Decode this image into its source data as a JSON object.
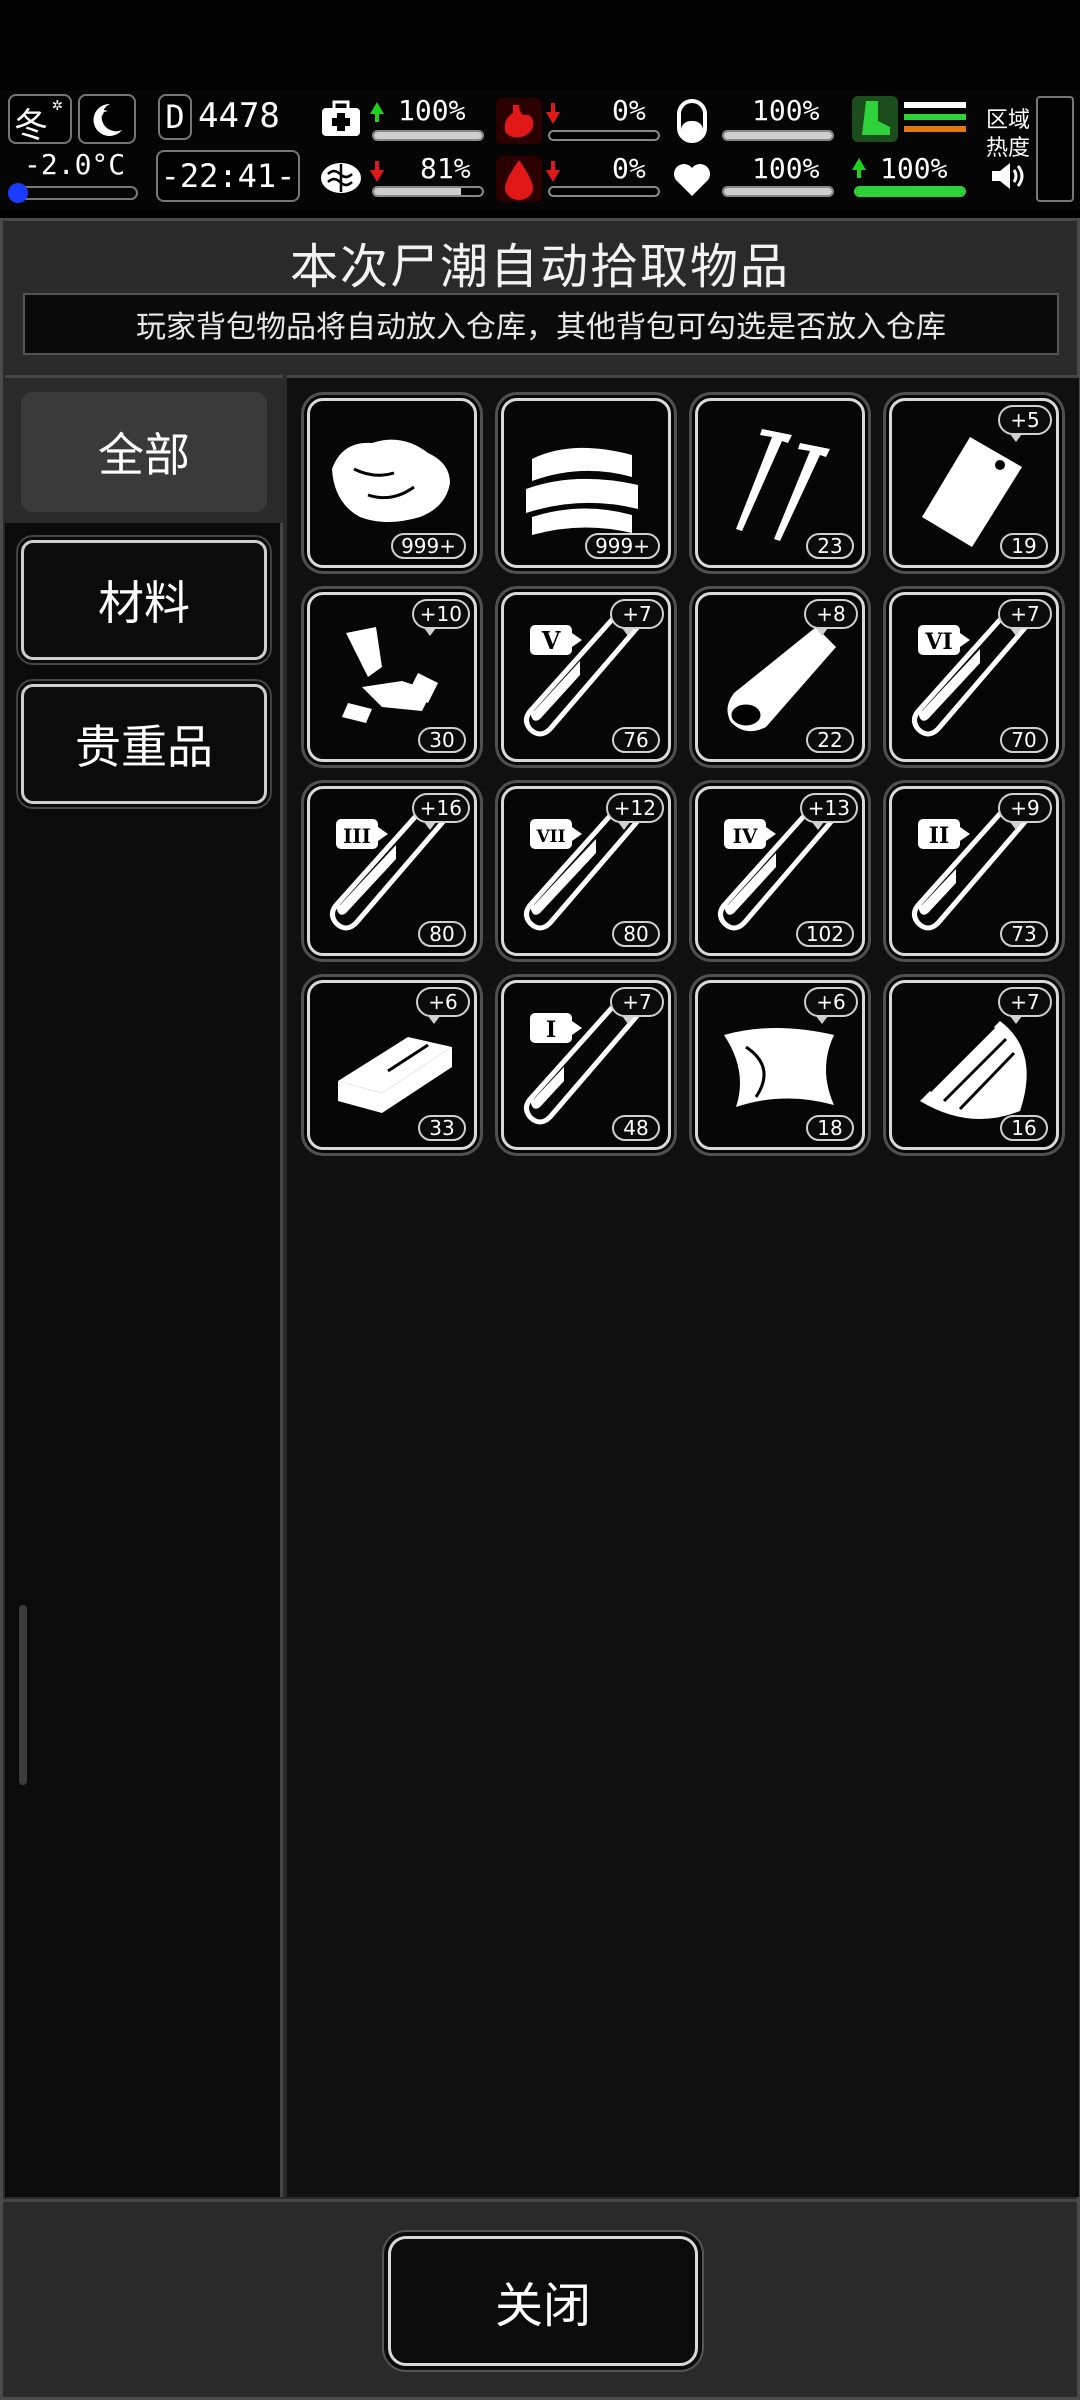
{
  "hud": {
    "season": "冬",
    "temperature": "-2.0°C",
    "day_counter": "4478",
    "day_prefix": "D",
    "clock": "-22:41-",
    "stats": {
      "health": {
        "value": "100%",
        "trend": "up",
        "level": 1.0
      },
      "hunger": {
        "value": "0%",
        "trend": "down",
        "level": 0.0
      },
      "medicine": {
        "value": "100%",
        "level": 1.0
      },
      "sanity": {
        "value": "81%",
        "trend": "down",
        "level": 0.81
      },
      "bleeding": {
        "value": "0%",
        "trend": "down",
        "level": 0.0
      },
      "heart": {
        "value": "100%",
        "level": 1.0
      },
      "stamina": {
        "value": "100%",
        "trend": "up",
        "level": 1.0
      }
    },
    "zone_heat_label_1": "区域",
    "zone_heat_label_2": "热度",
    "colors": {
      "up": "#1ed11e",
      "down": "#e01818",
      "stamina": "#2fd23a"
    }
  },
  "panel": {
    "title": "本次尸潮自动拾取物品",
    "notice": "玩家背包物品将自动放入仓库，其他背包可勾选是否放入仓库"
  },
  "categories": [
    {
      "label": "全部",
      "active": true
    },
    {
      "label": "材料",
      "active": false
    },
    {
      "label": "贵重品",
      "active": false
    }
  ],
  "items": [
    {
      "icon": "cloth-sack-icon",
      "count": "999+",
      "bonus": ""
    },
    {
      "icon": "folded-cloth-icon",
      "count": "999+",
      "bonus": ""
    },
    {
      "icon": "screws-icon",
      "count": "23",
      "bonus": ""
    },
    {
      "icon": "plastic-bag-icon",
      "count": "19",
      "bonus": "+5"
    },
    {
      "icon": "scrap-pieces-icon",
      "count": "30",
      "bonus": "+10"
    },
    {
      "icon": "test-tube-v-icon",
      "tier": "V",
      "count": "76",
      "bonus": "+7"
    },
    {
      "icon": "wood-log-icon",
      "count": "22",
      "bonus": "+8"
    },
    {
      "icon": "test-tube-vi-icon",
      "tier": "VI",
      "count": "70",
      "bonus": "+7"
    },
    {
      "icon": "test-tube-iii-icon",
      "tier": "III",
      "count": "80",
      "bonus": "+16"
    },
    {
      "icon": "test-tube-vii-icon",
      "tier": "VII",
      "count": "80",
      "bonus": "+12"
    },
    {
      "icon": "test-tube-iv-icon",
      "tier": "IV",
      "count": "102",
      "bonus": "+13"
    },
    {
      "icon": "test-tube-ii-icon",
      "tier": "II",
      "count": "73",
      "bonus": "+9"
    },
    {
      "icon": "board-icon",
      "count": "33",
      "bonus": "+6"
    },
    {
      "icon": "test-tube-i-icon",
      "tier": "I",
      "count": "48",
      "bonus": "+7"
    },
    {
      "icon": "leather-hide-icon",
      "count": "18",
      "bonus": "+6"
    },
    {
      "icon": "scrap-metal-icon",
      "count": "16",
      "bonus": "+7"
    }
  ],
  "footer": {
    "close_label": "关闭"
  }
}
